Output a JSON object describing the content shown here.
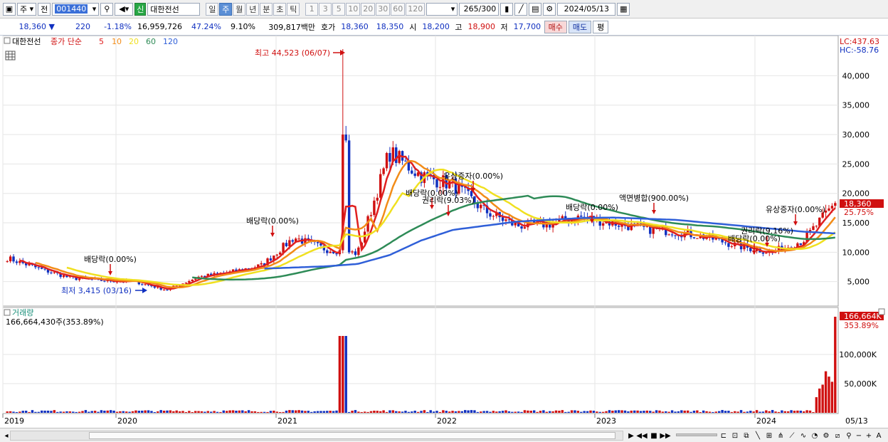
{
  "toolbar": {
    "market": "주",
    "prev": "전",
    "code": "001440",
    "sin_badge": "신",
    "name": "대한전선",
    "periods": [
      {
        "label": "일",
        "active": false
      },
      {
        "label": "주",
        "active": true
      },
      {
        "label": "월",
        "active": false
      },
      {
        "label": "년",
        "active": false
      },
      {
        "label": "분",
        "active": false
      },
      {
        "label": "초",
        "active": false
      },
      {
        "label": "틱",
        "active": false
      }
    ],
    "intervals": [
      "1",
      "3",
      "5",
      "10",
      "20",
      "30",
      "60",
      "120"
    ],
    "count": "265",
    "count_max": "/300",
    "date": "2024/05/13"
  },
  "quote": {
    "price": "18,360",
    "change": "220",
    "change_pct": "-1.18%",
    "volume": "16,959,726",
    "vol_ratio": "47.24%",
    "turnover": "9.10%",
    "amount": "309,817백만",
    "hoga_label": "호가",
    "ask": "18,360",
    "bid": "18,350",
    "open_label": "시",
    "open": "18,200",
    "high_label": "고",
    "high": "18,900",
    "low_label": "저",
    "low": "17,700",
    "buy_label": "매수",
    "sell_label": "매도",
    "eval_label": "평"
  },
  "legend": {
    "stock": "대한전선",
    "indicator": "종가 단순",
    "ma": [
      {
        "label": "5",
        "color": "#e02020"
      },
      {
        "label": "10",
        "color": "#f28c18"
      },
      {
        "label": "20",
        "color": "#f0e020"
      },
      {
        "label": "60",
        "color": "#2e8b57"
      },
      {
        "label": "120",
        "color": "#2f5fd8"
      }
    ]
  },
  "price_axis": {
    "ticks": [
      "40,000",
      "35,000",
      "30,000",
      "25,000",
      "20,000",
      "15,000",
      "10,000",
      "5,000"
    ],
    "lc": "LC:437.63",
    "hc": "HC:-58.76",
    "current": "18,360",
    "pct": "25.75%"
  },
  "volume_pane": {
    "title": "거래량",
    "detail": "166,664,430주(353.89%)",
    "ticks": [
      "100,000K",
      "50,000K"
    ],
    "current": "166,664K",
    "pct": "353.89%"
  },
  "x_axis": {
    "ticks": [
      "2019",
      "2020",
      "2021",
      "2022",
      "2023",
      "2024"
    ],
    "end": "05/13"
  },
  "annotations": {
    "max": "최고 44,523 (06/07)",
    "min": "최저 3,415 (03/16)",
    "events": [
      "배당락(0.00%)",
      "배당락(0.00%)",
      "유상증자(0.00%)",
      "배당락(0.00%)",
      "권리락(9.03%)",
      "배당락(0.00%)",
      "액면병합(900.00%)",
      "유상증자(0.00%)",
      "권리락(9.16%)",
      "배당락(0.00%)"
    ]
  },
  "chart_data": {
    "type": "line",
    "title": "",
    "xlabel": "",
    "ylabel": "",
    "ylim": [
      0,
      45000
    ],
    "x": [
      "2019-01",
      "2019-04",
      "2019-07",
      "2019-10",
      "2020-01",
      "2020-03",
      "2020-06",
      "2020-09",
      "2020-12",
      "2021-02",
      "2021-04",
      "2021-06",
      "2021-07",
      "2021-09",
      "2021-11",
      "2022-01",
      "2022-04",
      "2022-06",
      "2022-09",
      "2022-12",
      "2023-02",
      "2023-05",
      "2023-08",
      "2023-11",
      "2024-01",
      "2024-03",
      "2024-05"
    ],
    "series": [
      {
        "name": "5",
        "values": [
          9000,
          7200,
          5600,
          5200,
          5000,
          3600,
          5800,
          6600,
          7800,
          12500,
          10500,
          9800,
          27000,
          23000,
          21500,
          17000,
          14500,
          14800,
          16000,
          15000,
          14000,
          13500,
          12500,
          11000,
          10000,
          12000,
          18360
        ]
      },
      {
        "name": "120",
        "values": [
          null,
          null,
          null,
          null,
          null,
          null,
          null,
          null,
          7200,
          7400,
          7600,
          8000,
          9500,
          12000,
          13800,
          14500,
          15200,
          15500,
          15800,
          15900,
          15700,
          15500,
          15000,
          14500,
          14000,
          13500,
          13200
        ]
      }
    ]
  }
}
